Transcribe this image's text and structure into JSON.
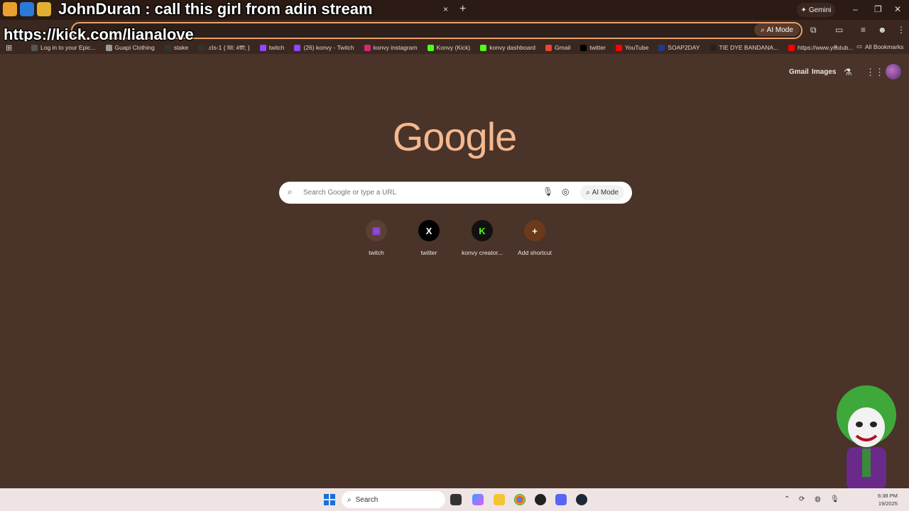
{
  "overlay": {
    "message": "JohnDuran : call this girl from adin stream",
    "url_text": "https://kick.com/lianalove"
  },
  "tabbar": {
    "new_tab": "+",
    "close_tab": "×",
    "gemini_label": "Gemini",
    "minimize": "–",
    "restore": "❐",
    "close": "✕"
  },
  "toolbar": {
    "ai_mode_label": "AI Mode"
  },
  "bookmarks": [
    {
      "label": "Log in to your Epic...",
      "color": "#555555"
    },
    {
      "label": "Guapi Clothing",
      "color": "#9a9a9a"
    },
    {
      "label": "stake",
      "color": "#333333"
    },
    {
      "label": ".cls-1 { fill: #fff; }",
      "color": "#333333"
    },
    {
      "label": "twitch",
      "color": "#9146ff"
    },
    {
      "label": "(26) konvy - Twitch",
      "color": "#9146ff"
    },
    {
      "label": "konvy instagram",
      "color": "#d62976"
    },
    {
      "label": "Konvy (Kick)",
      "color": "#53fc18"
    },
    {
      "label": "konvy dashboard",
      "color": "#53fc18"
    },
    {
      "label": "Gmail",
      "color": "#ea4335"
    },
    {
      "label": "twitter",
      "color": "#000000"
    },
    {
      "label": "YouTube",
      "color": "#ff0000"
    },
    {
      "label": "SOAP2DAY",
      "color": "#1a3c8a"
    },
    {
      "label": "TIE DYE BANDANA...",
      "color": "#222222"
    },
    {
      "label": "https://www.youtub...",
      "color": "#ff0000"
    }
  ],
  "bookmarks_more": "»",
  "all_bookmarks": "All Bookmarks",
  "header_links": {
    "gmail": "Gmail",
    "images": "Images"
  },
  "logo": "Google",
  "search": {
    "placeholder": "Search Google or type a URL",
    "ai_mode_label": "AI Mode"
  },
  "shortcuts": [
    {
      "label": "twitch",
      "glyph": "▣",
      "color": "#9146ff"
    },
    {
      "label": "twitter",
      "glyph": "X",
      "color": "#ffffff"
    },
    {
      "label": "konvy creator...",
      "glyph": "K",
      "color": "#53fc18"
    },
    {
      "label": "Add shortcut",
      "glyph": "+",
      "color": "#ffffff"
    }
  ],
  "taskbar": {
    "search_label": "Search",
    "time": "6:38 PM",
    "date": "19/2025"
  },
  "colors": {
    "background": "#4a3328",
    "logo": "#f5b88f",
    "omnibox_border": "#e8a070"
  }
}
